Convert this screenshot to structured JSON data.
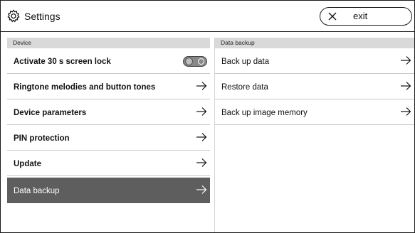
{
  "header": {
    "icon": "gear-icon",
    "title": "Settings",
    "exit_icon": "close-icon",
    "exit_label": "exit"
  },
  "device": {
    "section_title": "Device",
    "items": [
      {
        "label": "Activate 30 s screen lock",
        "control": "toggle",
        "toggle_on": false
      },
      {
        "label": "Ringtone melodies and button tones",
        "control": "arrow"
      },
      {
        "label": "Device parameters",
        "control": "arrow"
      },
      {
        "label": "PIN protection",
        "control": "arrow"
      },
      {
        "label": "Update",
        "control": "arrow"
      },
      {
        "label": "Data backup",
        "control": "arrow",
        "selected": true
      }
    ]
  },
  "data_backup": {
    "section_title": "Data backup",
    "items": [
      {
        "label": "Back up data"
      },
      {
        "label": "Restore data"
      },
      {
        "label": "Back up image memory"
      }
    ]
  },
  "colors": {
    "selected_row": "#5e5e5e",
    "section_header_bg": "#d9d9d9",
    "border": "#1a1a1a"
  }
}
